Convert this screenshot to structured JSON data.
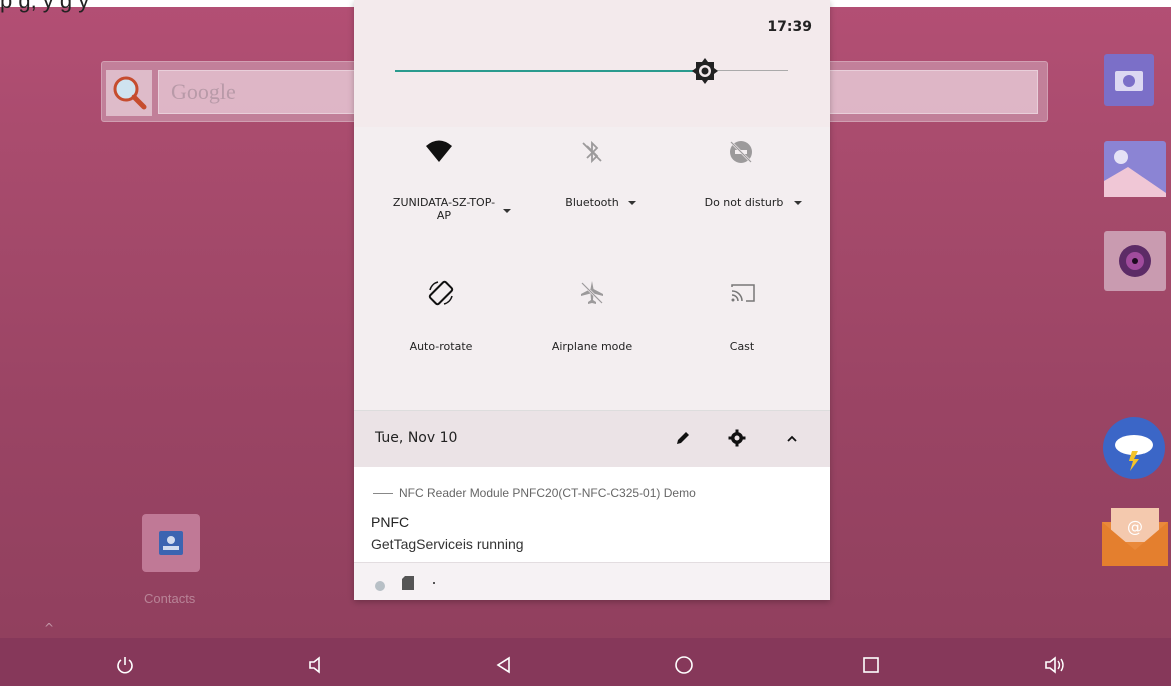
{
  "top_strip_text": "p                 g,  y             g     y",
  "search": {
    "placeholder": "Google"
  },
  "home": {
    "contacts_label": "Contacts"
  },
  "quick_settings": {
    "time": "17:39",
    "brightness_fraction": 0.79,
    "tiles": [
      {
        "label": "ZUNIDATA-SZ-TOP-AP",
        "label_line1": "ZUNIDATA-SZ-TOP-",
        "label_line2": "AP",
        "icon": "wifi-icon",
        "has_dropdown": true
      },
      {
        "label": "Bluetooth",
        "icon": "bluetooth-off-icon",
        "has_dropdown": true
      },
      {
        "label": "Do not disturb",
        "icon": "do-not-disturb-icon",
        "has_dropdown": true
      },
      {
        "label": "Auto-rotate",
        "icon": "auto-rotate-icon",
        "has_dropdown": false
      },
      {
        "label": "Airplane mode",
        "icon": "airplane-icon",
        "has_dropdown": false
      },
      {
        "label": "Cast",
        "icon": "cast-icon",
        "has_dropdown": false
      }
    ],
    "date": "Tue, Nov 10"
  },
  "notification": {
    "app_line": "NFC Reader Module PNFC20(CT-NFC-C325-01) Demo",
    "title": "PNFC",
    "body": "GetTagServiceis running"
  },
  "colors": {
    "accent": "#2a9b8e",
    "wallpaper": "#a54a6b",
    "navbar": "#86385a"
  }
}
